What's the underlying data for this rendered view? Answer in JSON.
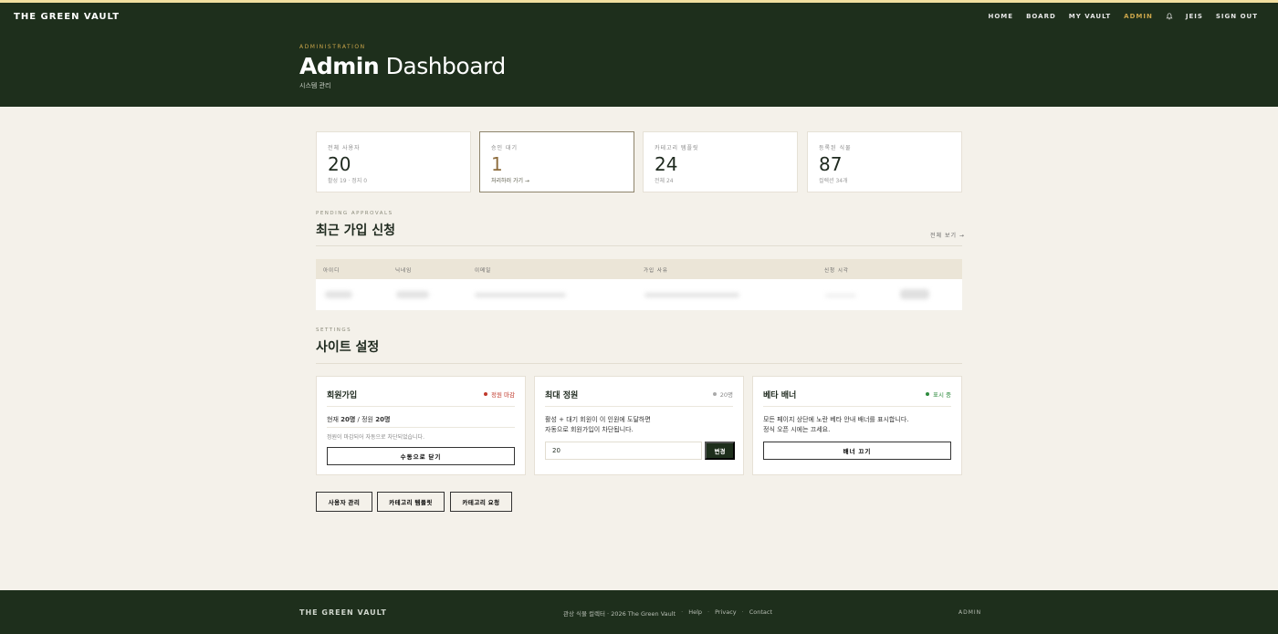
{
  "brand": "THE GREEN VAULT",
  "nav": {
    "items": [
      "HOME",
      "BOARD",
      "MY VAULT",
      "ADMIN",
      "JEIS",
      "SIGN OUT"
    ],
    "active": "ADMIN",
    "bell_icon": "bell-icon"
  },
  "hero": {
    "eyebrow": "ADMINISTRATION",
    "title_bold": "Admin",
    "title_rest": " Dashboard",
    "subtitle": "시스템 관리"
  },
  "stats": [
    {
      "label": "전체 사용자",
      "value": "20",
      "sub": "활성 19 · 정지 0"
    },
    {
      "label": "승인 대기",
      "value": "1",
      "sub": "처리하러 가기 →"
    },
    {
      "label": "카테고리 템플릿",
      "value": "24",
      "sub": "전체 24"
    },
    {
      "label": "등록된 식물",
      "value": "87",
      "sub": "컬렉션 34개"
    }
  ],
  "pending": {
    "eyebrow": "PENDING APPROVALS",
    "title_bold": "최근",
    "title_rest": " 가입 신청",
    "view_all": "전체 보기 →",
    "columns": [
      "아이디",
      "닉네임",
      "이메일",
      "가입 사유",
      "신청 시각"
    ]
  },
  "settings": {
    "eyebrow": "SETTINGS",
    "title_bold": "사이트",
    "title_rest": " 설정",
    "signup": {
      "title": "회원가입",
      "status": "정원 마감",
      "status_color": "#c0392b",
      "current_prefix": "현재 ",
      "current_value": "20명",
      "current_mid": " / 정원 ",
      "capacity_value": "20명",
      "note": "정원이 마감되어 자동으로 차단되었습니다.",
      "button": "수동으로 닫기"
    },
    "capacity": {
      "title": "최대 정원",
      "status": "20명",
      "status_color": "#999999",
      "desc_line1": "활성 + 대기 회원이 이 인원에 도달하면",
      "desc_line2": "자동으로 회원가입이 차단됩니다.",
      "input_value": "20",
      "apply": "변경"
    },
    "beta": {
      "title": "베타 배너",
      "status": "표시 중",
      "status_color": "#2e8b3e",
      "desc_line1": "모든 페이지 상단에 노란 베타 안내 배너를 표시합니다.",
      "desc_line2": "정식 오픈 시에는 끄세요.",
      "button": "배너 끄기"
    }
  },
  "quick_links": [
    "사용자 관리",
    "카테고리 템플릿",
    "카테고리 요청"
  ],
  "footer": {
    "brand": "THE GREEN VAULT",
    "copyright": "관상 식물 컬렉터 · 2026 The Green Vault",
    "links": [
      "Help",
      "Privacy",
      "Contact"
    ],
    "admin": "ADMIN"
  }
}
